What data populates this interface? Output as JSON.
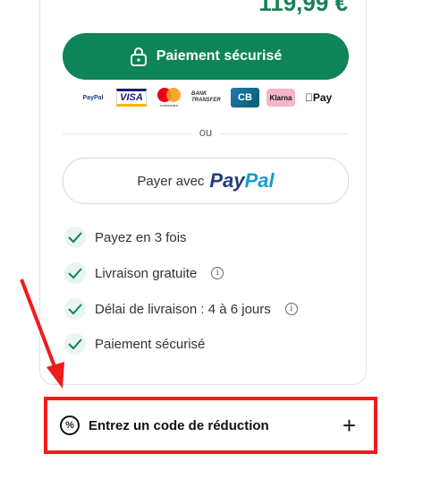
{
  "summary": {
    "total_price": "119,99 €"
  },
  "checkout": {
    "secure_pay_label": "Paiement sécurisé",
    "methods": [
      {
        "name": "PayPal",
        "icon": "paypal-logo"
      },
      {
        "name": "VISA",
        "icon": "visa-logo"
      },
      {
        "name": "mastercard",
        "icon": "mastercard-logo"
      },
      {
        "name": "BANK TRANSFER",
        "icon": "bank-transfer-logo"
      },
      {
        "name": "CB",
        "icon": "cb-logo"
      },
      {
        "name": "Klarna",
        "icon": "klarna-logo"
      },
      {
        "name": "Pay",
        "icon": "apple-pay-logo"
      }
    ],
    "or_label": "ou",
    "paypal_button": {
      "prefix": "Payer avec",
      "brand_a": "Pay",
      "brand_b": "Pal"
    }
  },
  "features": [
    {
      "label": "Payez en 3 fois",
      "has_info": false
    },
    {
      "label": "Livraison gratuite",
      "has_info": true
    },
    {
      "label": "Délai de livraison : 4 à 6 jours",
      "has_info": true
    },
    {
      "label": "Paiement sécurisé",
      "has_info": false
    }
  ],
  "promo": {
    "label": "Entrez un code de réduction",
    "toggle_symbol": "+",
    "icon": "percent-icon"
  },
  "colors": {
    "brand_green": "#0e8458",
    "highlight_red": "#ee1c1c"
  }
}
